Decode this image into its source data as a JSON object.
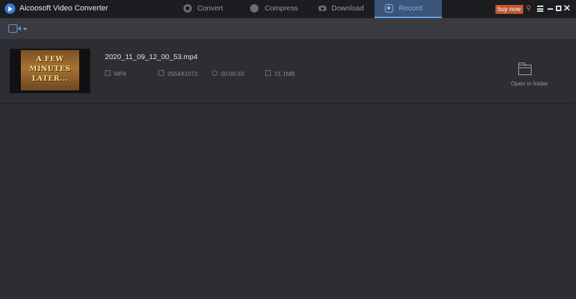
{
  "app": {
    "title": "Aicoosoft Video Converter"
  },
  "tabs": [
    {
      "label": "Convert",
      "icon": "convert-icon",
      "active": false
    },
    {
      "label": "Compress",
      "icon": "compress-icon",
      "active": false
    },
    {
      "label": "Download",
      "icon": "download-icon",
      "active": false
    },
    {
      "label": "Record",
      "icon": "record-icon",
      "active": true
    }
  ],
  "window_controls": {
    "buy_now": "buy now",
    "buy_color": "#c0572f"
  },
  "toolbar": {
    "camera_icon": "video-camera-icon"
  },
  "files": [
    {
      "name": "2020_11_09_12_00_53.mp4",
      "thumbnail_text": [
        "A FEW",
        "MINUTES",
        "LATER..."
      ],
      "format": "MP4",
      "resolution": "2554X1072",
      "duration": "00:00:33",
      "size": "21.1MB",
      "action": "Open in folder"
    }
  ],
  "colors": {
    "accent": "#5b9ae6",
    "active_tab_bg": "#3a5579",
    "background": "#2d2e33"
  }
}
